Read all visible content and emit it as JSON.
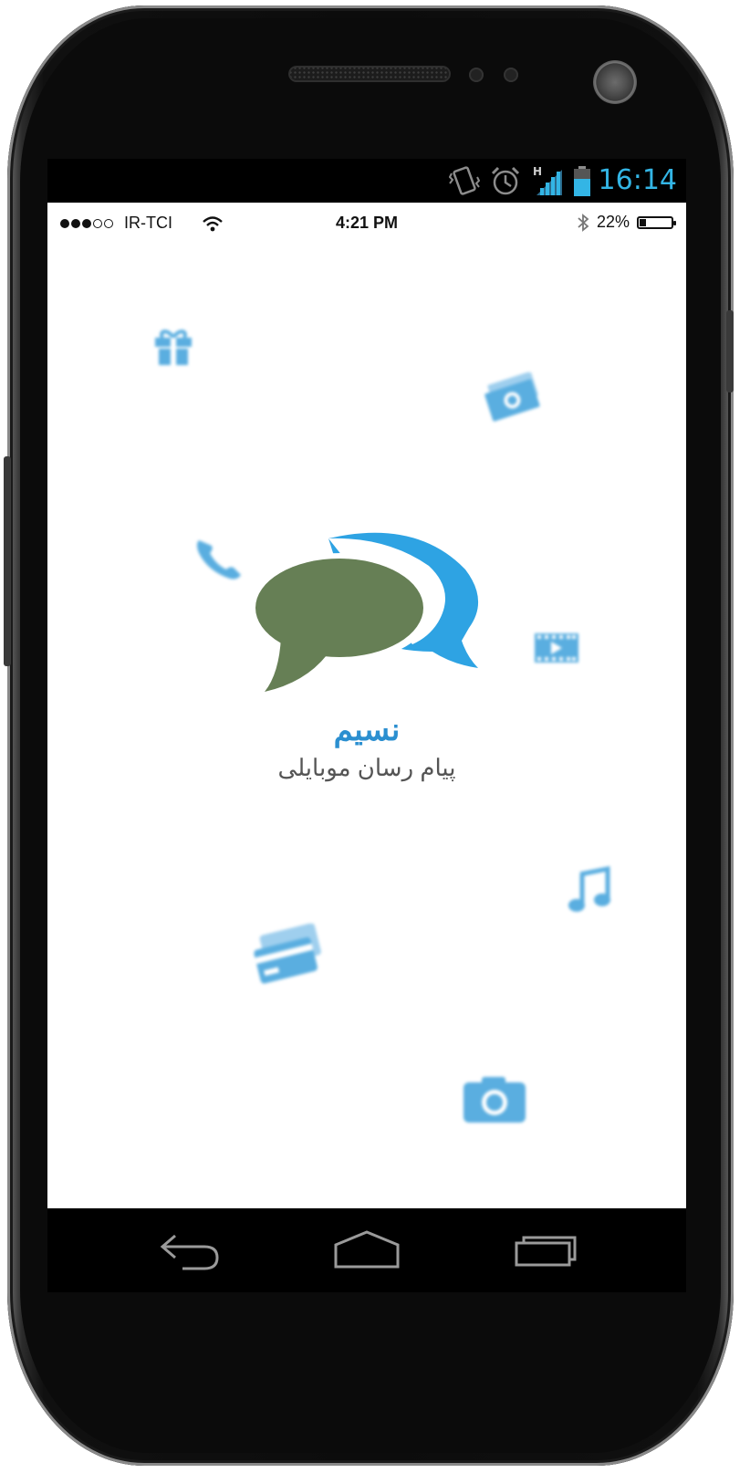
{
  "android_status": {
    "time": "16:14"
  },
  "ios_status": {
    "signal_dots_filled": 3,
    "signal_dots_total": 5,
    "carrier": "IR-TCI",
    "time": "4:21 PM",
    "battery_percent_label": "22%",
    "battery_level": 0.22
  },
  "app": {
    "title": "نسیم",
    "subtitle": "پیام رسان موبایلی"
  },
  "floating_icons": [
    "gift-icon",
    "money-icon",
    "phone-icon",
    "video-icon",
    "music-icon",
    "credit-card-icon",
    "camera-icon"
  ],
  "colors": {
    "accent_blue": "#2b8fd0",
    "bubble_blue": "#2ea3e3",
    "bubble_green": "#667f55",
    "icon_blue": "#5aaee0",
    "android_clock": "#33b5e5"
  },
  "nav": [
    "back-icon",
    "home-icon",
    "recent-apps-icon"
  ]
}
